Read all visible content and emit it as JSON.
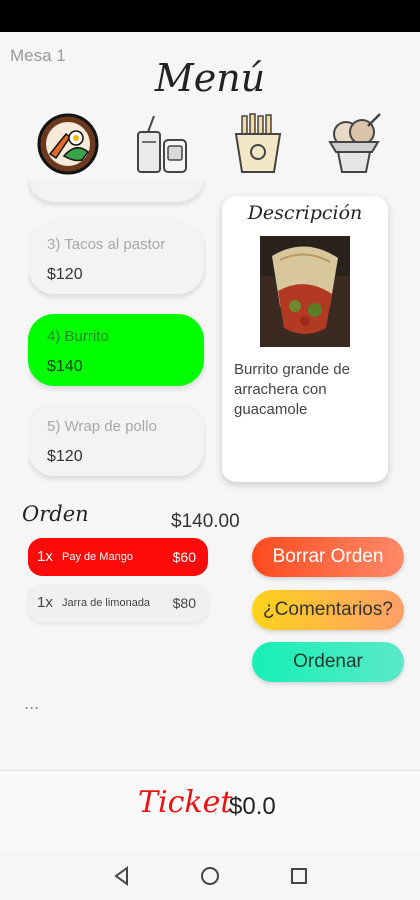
{
  "app": {
    "table_label": "Mesa 1",
    "title": "Menú"
  },
  "categories": [
    {
      "name": "platillos-category-icon"
    },
    {
      "name": "bebidas-category-icon"
    },
    {
      "name": "snacks-category-icon"
    },
    {
      "name": "postres-category-icon"
    }
  ],
  "menu_items": [
    {
      "name": "3) Tacos al pastor",
      "price": "$120"
    },
    {
      "name": "4) Burrito",
      "price": "$140"
    },
    {
      "name": "5) Wrap de pollo",
      "price": "$120"
    }
  ],
  "description": {
    "title": "Descripción",
    "photo": "burrito-photo",
    "text": "Burrito grande de arrachera con guacamole"
  },
  "order": {
    "label": "Orden",
    "total": "$140.00",
    "items": [
      {
        "qty": "1x",
        "name": "Pay de Mango",
        "price": "$60"
      },
      {
        "qty": "1x",
        "name": "Jarra de limonada",
        "price": "$80"
      }
    ],
    "ellipsis": "..."
  },
  "actions": {
    "clear": "Borrar Orden",
    "comments": "¿Comentarios?",
    "order": "Ordenar"
  },
  "ticket": {
    "label": "Ticket",
    "total": "$0.0"
  },
  "colors": {
    "selected": "#00ff00",
    "order_highlight": "#ff0a0a",
    "ticket": "#ee1111"
  },
  "nav": {
    "back": "back-icon",
    "home": "home-icon",
    "recents": "recents-icon"
  }
}
